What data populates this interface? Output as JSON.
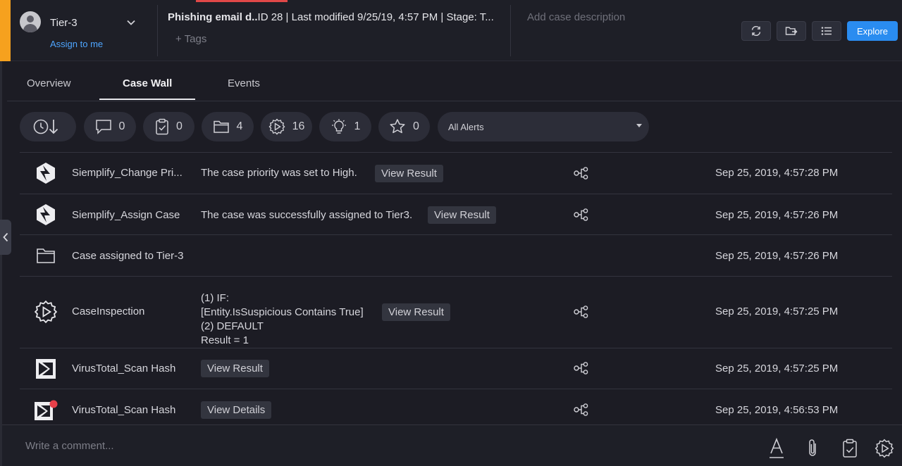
{
  "header": {
    "assignee": "Tier-3",
    "assign_link": "Assign to me",
    "case_title": "Phishing email d..",
    "case_meta": "ID 28 | Last modified 9/25/19, 4:57 PM | Stage: T...",
    "tags": "+ Tags",
    "description_placeholder": "Add case description",
    "explore_label": "Explore"
  },
  "tabs": [
    {
      "label": "Overview"
    },
    {
      "label": "Case Wall"
    },
    {
      "label": "Events"
    }
  ],
  "filters": {
    "comments": "0",
    "tasks": "0",
    "attachments": "4",
    "playbooks": "16",
    "insights": "1",
    "favorites": "0",
    "alerts_select": "All Alerts"
  },
  "rows": [
    {
      "name": "Siemplify_Change Pri...",
      "message": "The case priority was set to High.",
      "button": "View Result",
      "time": "Sep 25, 2019, 4:57:28 PM"
    },
    {
      "name": "Siemplify_Assign Case",
      "message": "The case was successfully assigned to Tier3.",
      "button": "View Result",
      "time": "Sep 25, 2019, 4:57:26 PM"
    },
    {
      "name": "Case assigned to Tier-3",
      "time": "Sep 25, 2019, 4:57:26 PM"
    },
    {
      "name": "CaseInspection",
      "lines": [
        "(1) IF:",
        "[Entity.IsSuspicious Contains True]",
        "(2) DEFAULT",
        "Result = 1"
      ],
      "button": "View Result",
      "time": "Sep 25, 2019, 4:57:25 PM"
    },
    {
      "name": "VirusTotal_Scan Hash",
      "button": "View Result",
      "time": "Sep 25, 2019, 4:57:25 PM"
    },
    {
      "name": "VirusTotal_Scan Hash",
      "button": "View Details",
      "time": "Sep 25, 2019, 4:56:53 PM"
    }
  ],
  "comment": {
    "placeholder": "Write a comment..."
  },
  "colors": {
    "accent": "#f6a11e",
    "primary": "#2a8cf0",
    "alert_dot": "#e8404a"
  }
}
